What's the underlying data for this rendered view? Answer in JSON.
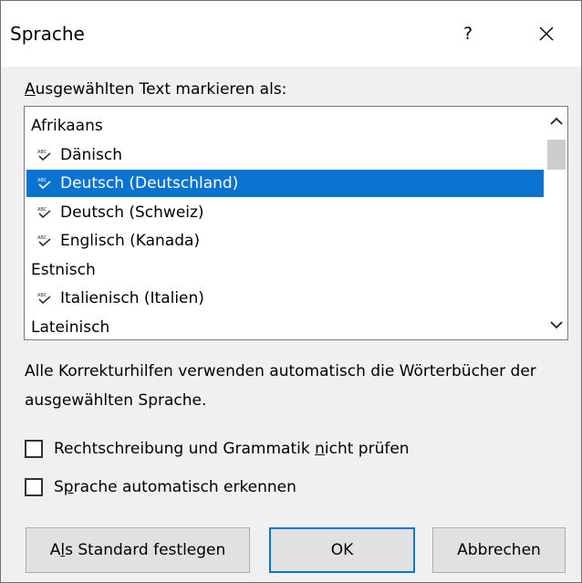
{
  "dialog": {
    "title": "Sprache",
    "help_label": "?",
    "close_icon": "close-icon"
  },
  "prompt": {
    "accel": "A",
    "rest": "usgewählten Text markieren als:"
  },
  "languages": [
    {
      "label": "Afrikaans",
      "has_spell_icon": false,
      "selected": false
    },
    {
      "label": "Dänisch",
      "has_spell_icon": true,
      "selected": false
    },
    {
      "label": "Deutsch (Deutschland)",
      "has_spell_icon": true,
      "selected": true
    },
    {
      "label": "Deutsch (Schweiz)",
      "has_spell_icon": true,
      "selected": false
    },
    {
      "label": "Englisch (Kanada)",
      "has_spell_icon": true,
      "selected": false
    },
    {
      "label": "Estnisch",
      "has_spell_icon": false,
      "selected": false
    },
    {
      "label": "Italienisch (Italien)",
      "has_spell_icon": true,
      "selected": false
    },
    {
      "label": "Lateinisch",
      "has_spell_icon": false,
      "selected": false
    }
  ],
  "info_text": "Alle Korrekturhilfen verwenden automatisch die Wörterbücher der ausgewählten Sprache.",
  "options": {
    "no_proofing": {
      "before": "Rechtschreibung und Grammatik ",
      "accel": "n",
      "after": "icht prüfen",
      "checked": false
    },
    "auto_detect": {
      "before": "S",
      "accel": "p",
      "after": "rache automatisch erkennen",
      "checked": false
    }
  },
  "buttons": {
    "set_default": {
      "before": "A",
      "accel": "l",
      "after": "s Standard festlegen"
    },
    "ok": "OK",
    "cancel": "Abbrechen"
  },
  "colors": {
    "selection": "#0a72d1",
    "default_button_border": "#0078d7"
  }
}
